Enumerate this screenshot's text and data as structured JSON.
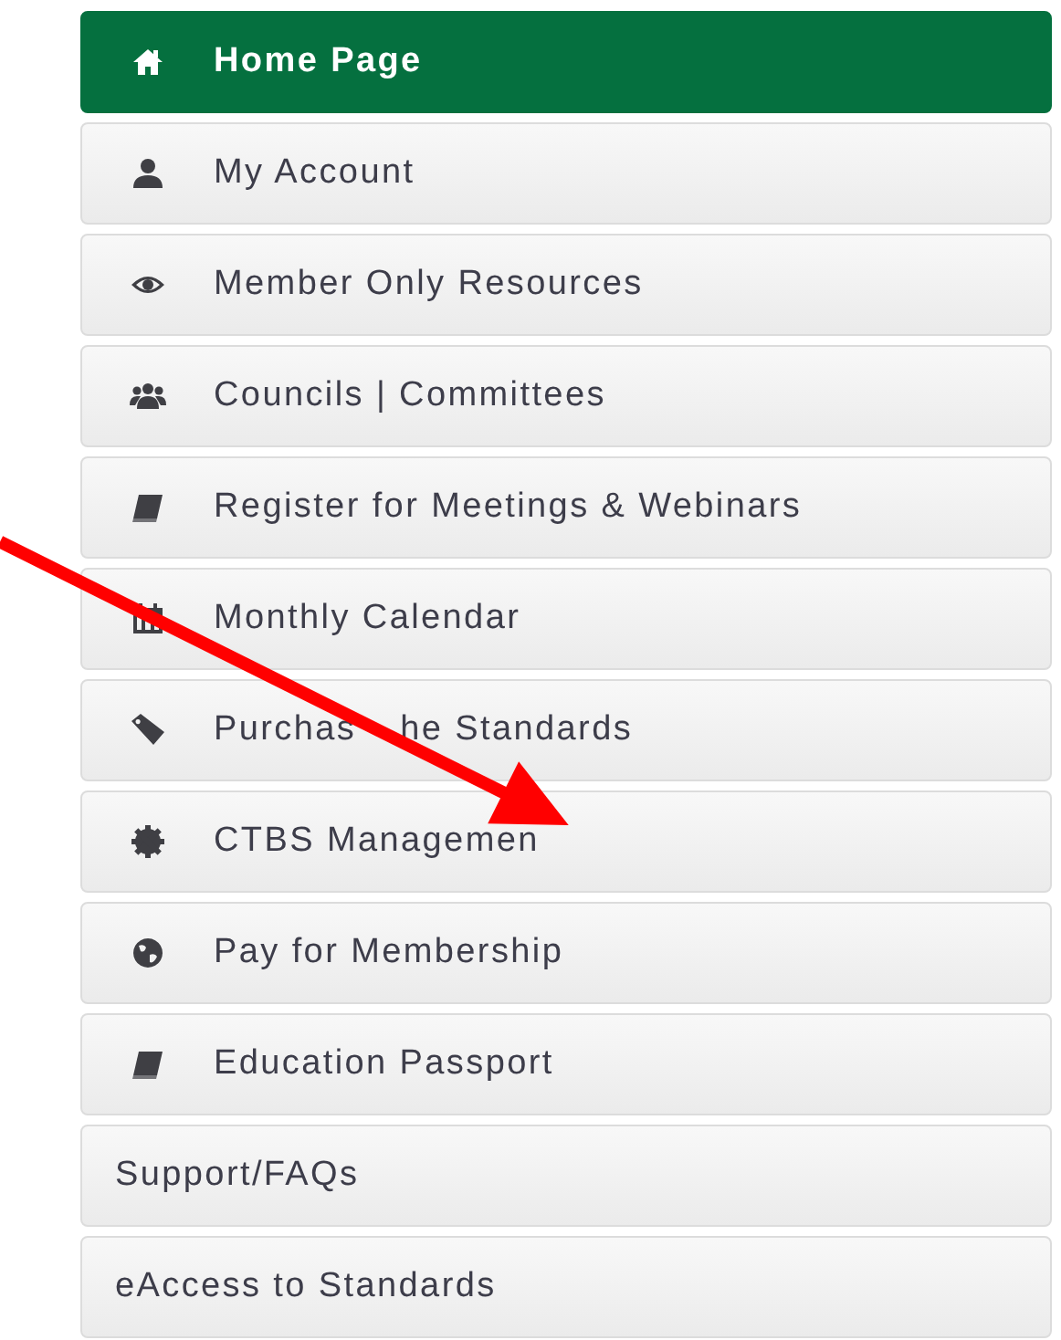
{
  "menu": {
    "items": [
      {
        "label": "Home Page",
        "kind": "icon",
        "selected": true
      },
      {
        "label": "My Account",
        "kind": "icon",
        "selected": false
      },
      {
        "label": "Member Only Resources",
        "kind": "icon",
        "selected": false
      },
      {
        "label": "Councils | Committees",
        "kind": "icon",
        "selected": false
      },
      {
        "label": "Register for Meetings & Webinars",
        "kind": "icon",
        "selected": false
      },
      {
        "label": "Monthly Calendar",
        "kind": "icon",
        "selected": false
      },
      {
        "label": "Purchas",
        "label_2": "he Standards",
        "kind": "icon",
        "selected": false
      },
      {
        "label": "CTBS Managemen",
        "kind": "icon",
        "selected": false
      },
      {
        "label": "Pay for Membership",
        "kind": "icon",
        "selected": false
      },
      {
        "label": "Education Passport",
        "kind": "icon",
        "selected": false
      },
      {
        "label": "Support/FAQs",
        "kind": "plain",
        "selected": false
      },
      {
        "label": "eAccess to Standards",
        "kind": "plain",
        "selected": false
      }
    ]
  }
}
